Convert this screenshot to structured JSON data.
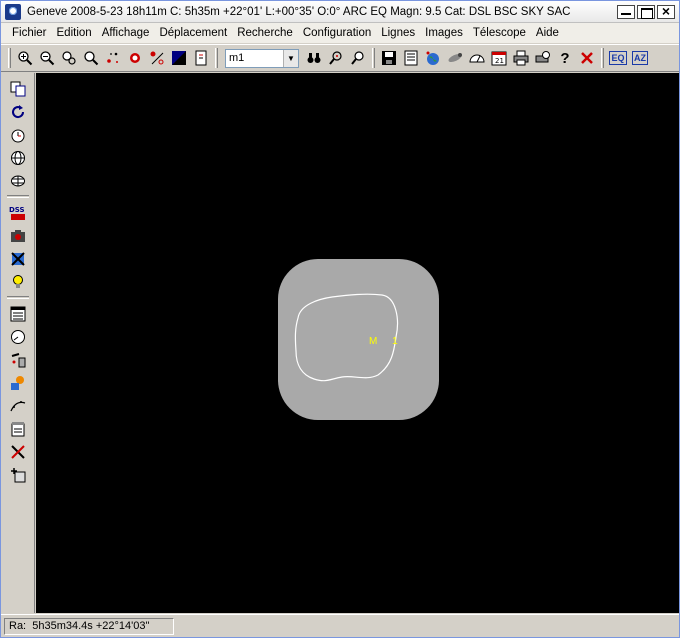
{
  "window": {
    "title": "Geneve 2008-5-23  18h11m C:  5h35m +22°01' L:+00°35' O:0° ARC EQ Magn: 9.5 Cat: DSL BSC SKY SAC"
  },
  "menu": [
    "Fichier",
    "Edition",
    "Affichage",
    "Déplacement",
    "Recherche",
    "Configuration",
    "Lignes",
    "Images",
    "Télescope",
    "Aide"
  ],
  "toolbar": {
    "search_value": "m1",
    "eq_label": "EQ",
    "az_label": "AZ",
    "colors": {
      "dark": "#000080",
      "red": "#cc0000"
    }
  },
  "sky": {
    "object_label": "M 1",
    "colors": {
      "background": "#000000",
      "patch": "#a0a0a0",
      "outline": "#ffffff",
      "label": "#ffff00"
    }
  },
  "status": {
    "coords": "Ra:  5h35m34.4s +22°14'03\""
  }
}
